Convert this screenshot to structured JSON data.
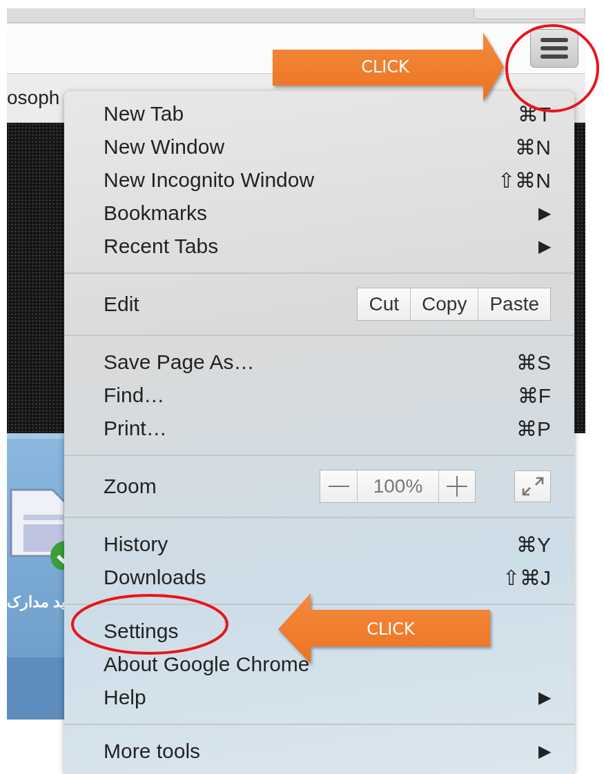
{
  "page": {
    "tab_text": "osoph",
    "caption": "ید مدارک"
  },
  "menu": {
    "sections": [
      {
        "items": [
          {
            "kind": "item",
            "label": "New Tab",
            "shortcut": "⌘T"
          },
          {
            "kind": "item",
            "label": "New Window",
            "shortcut": "⌘N"
          },
          {
            "kind": "item",
            "label": "New Incognito Window",
            "shortcut": "⇧⌘N"
          },
          {
            "kind": "item",
            "label": "Bookmarks",
            "submenu": "▶"
          },
          {
            "kind": "item",
            "label": "Recent Tabs",
            "submenu": "▶"
          }
        ]
      },
      {
        "items": [
          {
            "kind": "edit",
            "label": "Edit",
            "buttons": [
              "Cut",
              "Copy",
              "Paste"
            ]
          }
        ]
      },
      {
        "items": [
          {
            "kind": "item",
            "label": "Save Page As…",
            "shortcut": "⌘S"
          },
          {
            "kind": "item",
            "label": "Find…",
            "shortcut": "⌘F"
          },
          {
            "kind": "item",
            "label": "Print…",
            "shortcut": "⌘P"
          }
        ]
      },
      {
        "items": [
          {
            "kind": "zoom",
            "label": "Zoom",
            "value": "100%"
          }
        ]
      },
      {
        "items": [
          {
            "kind": "item",
            "label": "History",
            "shortcut": "⌘Y"
          },
          {
            "kind": "item",
            "label": "Downloads",
            "shortcut": "⇧⌘J"
          }
        ]
      },
      {
        "items": [
          {
            "kind": "item",
            "label": "Settings"
          },
          {
            "kind": "item",
            "label": "About Google Chrome"
          },
          {
            "kind": "item",
            "label": "Help",
            "submenu": "▶"
          }
        ]
      },
      {
        "items": [
          {
            "kind": "item",
            "label": "More tools",
            "submenu": "▶"
          }
        ]
      }
    ]
  },
  "annotations": [
    {
      "kind": "arrow_right",
      "label": "CLICK"
    },
    {
      "kind": "arrow_left",
      "label": "CLICK"
    },
    {
      "kind": "circle"
    },
    {
      "kind": "circle"
    }
  ]
}
